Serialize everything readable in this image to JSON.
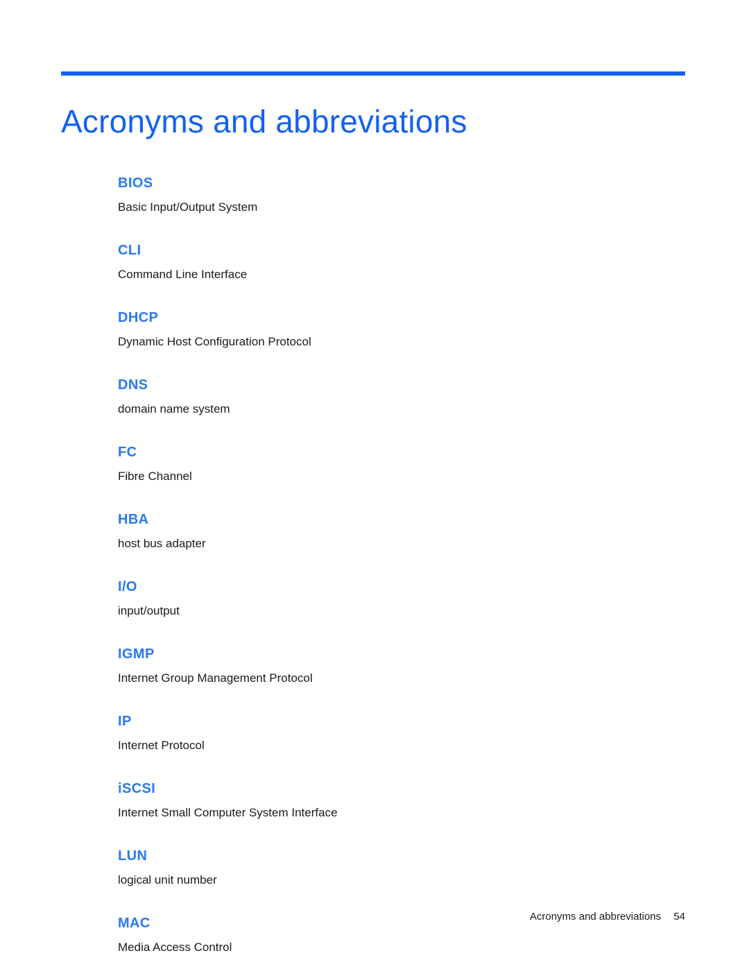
{
  "document": {
    "title": "Acronyms and abbreviations",
    "accent_color": "#1461f0",
    "term_color": "#2878f0",
    "text_color": "#1a1a1a",
    "background_color": "#ffffff"
  },
  "glossary": {
    "entries": [
      {
        "term": "BIOS",
        "definition": "Basic Input/Output System"
      },
      {
        "term": "CLI",
        "definition": "Command Line Interface"
      },
      {
        "term": "DHCP",
        "definition": "Dynamic Host Configuration Protocol"
      },
      {
        "term": "DNS",
        "definition": "domain name system"
      },
      {
        "term": "FC",
        "definition": "Fibre Channel"
      },
      {
        "term": "HBA",
        "definition": "host bus adapter"
      },
      {
        "term": "I/O",
        "definition": "input/output"
      },
      {
        "term": "IGMP",
        "definition": "Internet Group Management Protocol"
      },
      {
        "term": "IP",
        "definition": "Internet Protocol"
      },
      {
        "term": "iSCSI",
        "definition": "Internet Small Computer System Interface"
      },
      {
        "term": "LUN",
        "definition": "logical unit number"
      },
      {
        "term": "MAC",
        "definition": "Media Access Control"
      }
    ]
  },
  "footer": {
    "section_label": "Acronyms and abbreviations",
    "page_number": "54"
  }
}
